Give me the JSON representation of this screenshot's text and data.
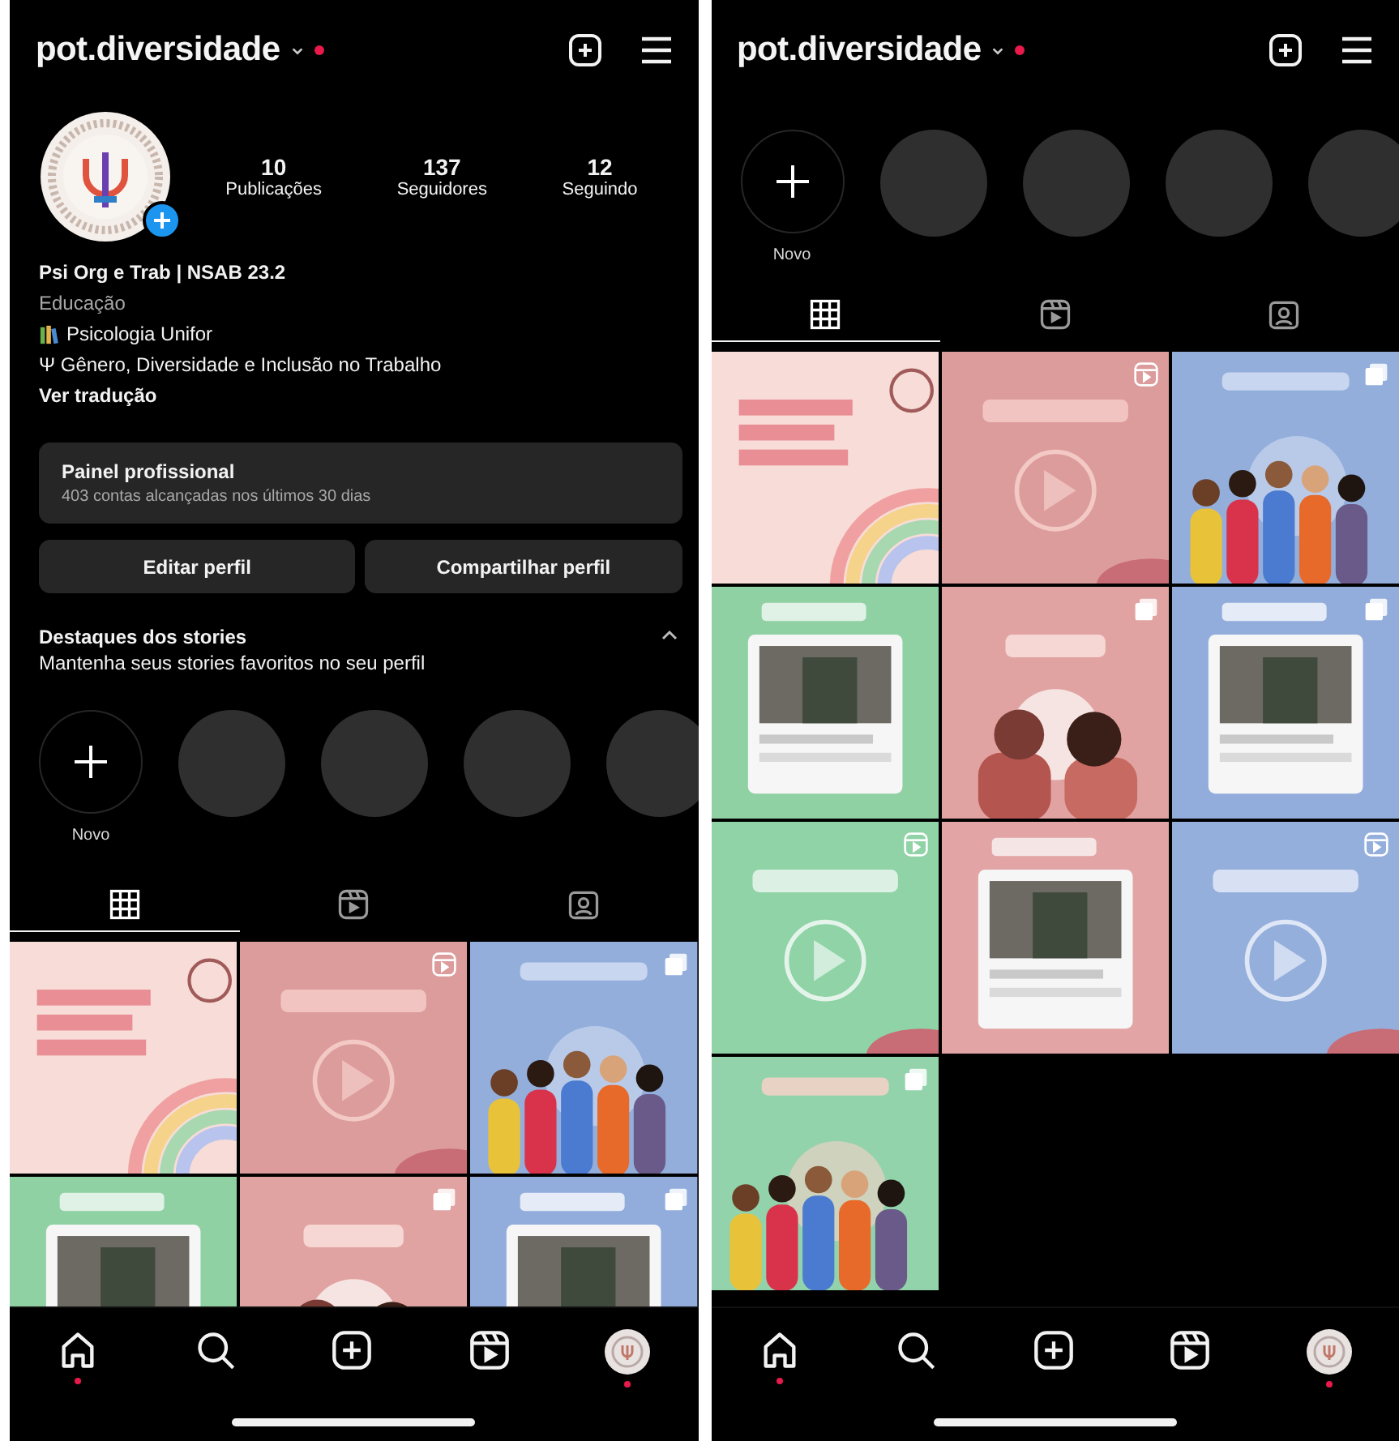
{
  "screens": [
    {
      "header": {
        "username": "pot.diversidade",
        "alert_dot": true
      },
      "profile": {
        "stats": [
          {
            "value": "10",
            "label": "Publicações"
          },
          {
            "value": "137",
            "label": "Seguidores"
          },
          {
            "value": "12",
            "label": "Seguindo"
          }
        ],
        "name": "Psi Org e Trab | NSAB 23.2",
        "category": "Educação",
        "bio": [
          {
            "kind": "books",
            "text": "Psicologia Unifor"
          },
          {
            "kind": "plain",
            "text": "Ψ Gênero, Diversidade e Inclusão no Trabalho"
          }
        ],
        "translate_link": "Ver tradução",
        "dashboard": {
          "title": "Painel profissional",
          "subtitle": "403 contas alcançadas nos últimos 30 dias"
        },
        "buttons": [
          "Editar perfil",
          "Compartilhar perfil"
        ]
      },
      "highlights": {
        "title": "Destaques dos stories",
        "subtitle": "Mantenha seus stories favoritos no seu perfil",
        "expanded": true,
        "items": [
          {
            "kind": "new",
            "label": "Novo"
          },
          {
            "kind": "empty"
          },
          {
            "kind": "empty"
          },
          {
            "kind": "empty"
          },
          {
            "kind": "empty"
          }
        ]
      },
      "tabs": [
        {
          "kind": "grid",
          "selected": true
        },
        {
          "kind": "reels",
          "selected": false
        },
        {
          "kind": "tagged",
          "selected": false
        }
      ],
      "posts": [
        {
          "kind": "picture",
          "reel": false,
          "carousel": false
        },
        {
          "kind": "picture",
          "reel": true,
          "carousel": false
        },
        {
          "kind": "picture",
          "reel": false,
          "carousel": true
        },
        {
          "kind": "picture",
          "reel": false,
          "carousel": false
        },
        {
          "kind": "picture",
          "reel": false,
          "carousel": true
        },
        {
          "kind": "picture",
          "reel": false,
          "carousel": true
        }
      ],
      "nav": [
        {
          "kind": "home",
          "dot": true
        },
        {
          "kind": "search",
          "dot": false
        },
        {
          "kind": "create",
          "dot": false
        },
        {
          "kind": "reels",
          "dot": false
        },
        {
          "kind": "profile",
          "dot": true
        }
      ]
    },
    {
      "header": {
        "username": "pot.diversidade",
        "alert_dot": true
      },
      "highlights": {
        "items": [
          {
            "kind": "new",
            "label": "Novo"
          },
          {
            "kind": "empty"
          },
          {
            "kind": "empty"
          },
          {
            "kind": "empty"
          },
          {
            "kind": "empty"
          }
        ]
      },
      "tabs": [
        {
          "kind": "grid",
          "selected": true
        },
        {
          "kind": "reels",
          "selected": false
        },
        {
          "kind": "tagged",
          "selected": false
        }
      ],
      "posts": [
        {
          "kind": "picture",
          "reel": false,
          "carousel": false
        },
        {
          "kind": "picture",
          "reel": true,
          "carousel": false
        },
        {
          "kind": "picture",
          "reel": false,
          "carousel": true
        },
        {
          "kind": "picture",
          "reel": false,
          "carousel": false
        },
        {
          "kind": "picture",
          "reel": false,
          "carousel": true
        },
        {
          "kind": "picture",
          "reel": false,
          "carousel": true
        },
        {
          "kind": "picture",
          "reel": true,
          "carousel": false
        },
        {
          "kind": "picture",
          "reel": false,
          "carousel": false
        },
        {
          "kind": "picture",
          "reel": true,
          "carousel": false
        },
        {
          "kind": "picture",
          "reel": false,
          "carousel": true
        }
      ],
      "nav": [
        {
          "kind": "home",
          "dot": true
        },
        {
          "kind": "search",
          "dot": false
        },
        {
          "kind": "create",
          "dot": false
        },
        {
          "kind": "reels",
          "dot": false
        },
        {
          "kind": "profile",
          "dot": true
        }
      ]
    }
  ]
}
